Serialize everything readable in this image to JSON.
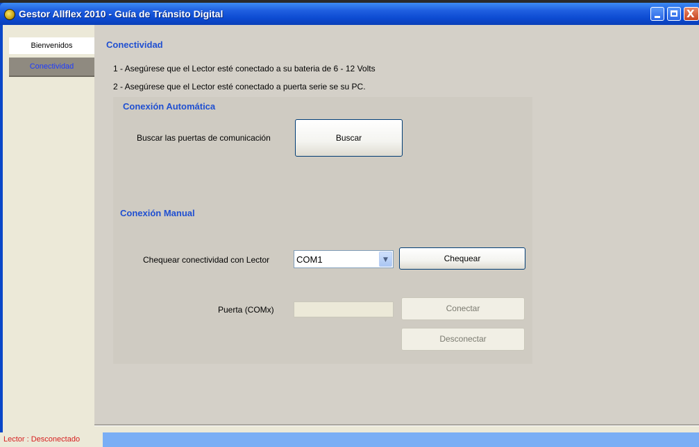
{
  "window": {
    "title": "Gestor Allflex 2010 - Guía de Tránsito Digital",
    "controls": [
      "minimize",
      "maximize",
      "close"
    ],
    "close_glyph": "X"
  },
  "sidebar": {
    "items": [
      {
        "label": "Bienvenidos",
        "selected": false
      },
      {
        "label": "Conectividad",
        "selected": true
      }
    ]
  },
  "main": {
    "heading": "Conectividad",
    "steps": [
      "1 - Asegúrese que el Lector esté conectado a su bateria de 6 - 12 Volts",
      "2 - Asegúrese que el Lector esté conectado a puerta serie se su PC."
    ],
    "auto": {
      "heading": "Conexión Automática",
      "label": "Buscar las puertas de comunicación",
      "button": "Buscar"
    },
    "manual": {
      "heading": "Conexión Manual",
      "check_label": "Chequear conectividad con Lector",
      "port_select": {
        "value": "COM1"
      },
      "check_button": "Chequear",
      "port_label": "Puerta (COMx)",
      "port_value": "",
      "connect_button": "Conectar",
      "disconnect_button": "Desconectar"
    }
  },
  "status": {
    "reader": "Lector : Desconectado"
  },
  "colors": {
    "titlebar": "#0c4ad1",
    "heading": "#1f4fd1",
    "status_text": "#d62020",
    "statusbar_accent": "#7aaef5"
  }
}
